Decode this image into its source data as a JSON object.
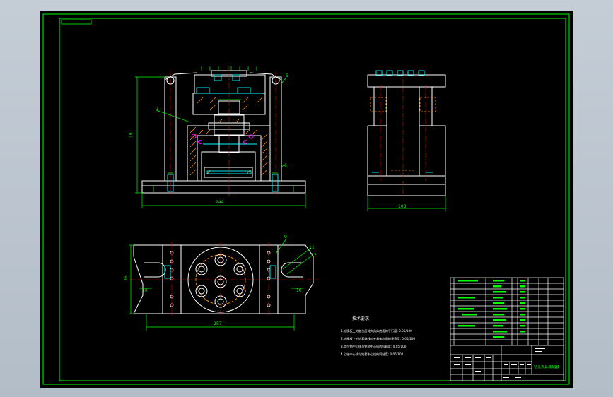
{
  "drawing": {
    "title_block": {
      "drawing_title": "钻孔夹具装配图",
      "sheet_size": "A1"
    },
    "technical_requirements": {
      "heading": "技术要求",
      "lines": [
        "1.钻模板上的定位面对夹具体底面的平行度: 0.05/100",
        "2.钻模板上的钻套轴线对夹具体底面的垂直度: 0.05/100",
        "3.定位销中心线与钻套中心线的同轴度: 0.05/100",
        "4.心轴中心线与钻套中心线的同轴度: 0.05/100"
      ]
    },
    "dimensions": {
      "front_width": "244",
      "front_height": "18",
      "side_width": "103",
      "top_width": "257",
      "top_height": "36",
      "top_slot_left": "10",
      "top_slot_right": "10"
    },
    "balloons": [
      "1",
      "5",
      "6",
      "9",
      "10",
      "11",
      "12"
    ],
    "colors": {
      "paper": "#000000",
      "border": "#00ff00",
      "outline": "#ffffff",
      "centerline": "#ff0000",
      "section_hatch": "#ff8c00",
      "hidden": "#ff8c00",
      "fastener": "#00ffff",
      "seal": "#ff00ff",
      "dimension": "#00ff00",
      "annotation": "#ffffff"
    }
  }
}
